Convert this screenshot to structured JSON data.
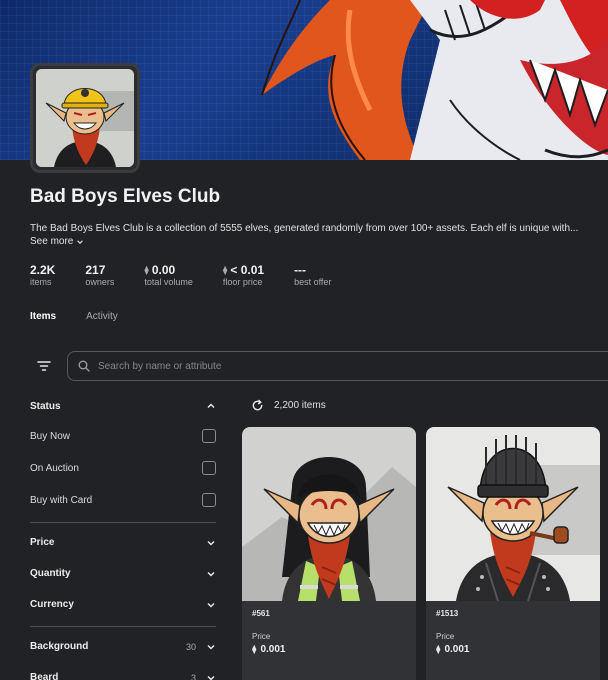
{
  "collection": {
    "name": "Bad Boys Elves Club",
    "description": "The Bad Boys Elves Club is a collection of 5555 elves, generated randomly from over 100+ assets. Each elf is unique with...",
    "see_more": "See more"
  },
  "stats": [
    {
      "value": "2.2K",
      "label": "items",
      "eth": false
    },
    {
      "value": "217",
      "label": "owners",
      "eth": false
    },
    {
      "value": "0.00",
      "label": "total volume",
      "eth": true
    },
    {
      "value": "< 0.01",
      "label": "floor price",
      "eth": true
    },
    {
      "value": "---",
      "label": "best offer",
      "eth": false
    }
  ],
  "tabs": {
    "items": "Items",
    "activity": "Activity"
  },
  "search": {
    "placeholder": "Search by name or attribute"
  },
  "filters": {
    "status": {
      "title": "Status",
      "options": [
        "Buy Now",
        "On Auction",
        "Buy with Card"
      ]
    },
    "price": "Price",
    "quantity": "Quantity",
    "currency": "Currency",
    "background": {
      "label": "Background",
      "count": "30"
    },
    "beard": {
      "label": "Beard",
      "count": "3"
    }
  },
  "results": {
    "count_text": "2,200 items"
  },
  "cards": [
    {
      "number": "#561",
      "price_label": "Price",
      "price": "0.001"
    },
    {
      "number": "#1513",
      "price_label": "Price",
      "price": "0.001"
    }
  ],
  "icons": {
    "eth": "ethereum-icon",
    "refresh": "refresh-icon",
    "filter": "filter-icon",
    "search": "search-icon",
    "chevron_up": "chevron-up-icon",
    "chevron_down": "chevron-down-icon"
  },
  "colors": {
    "background": "#202225",
    "card": "#303236",
    "banner": "#1a3f8f"
  }
}
